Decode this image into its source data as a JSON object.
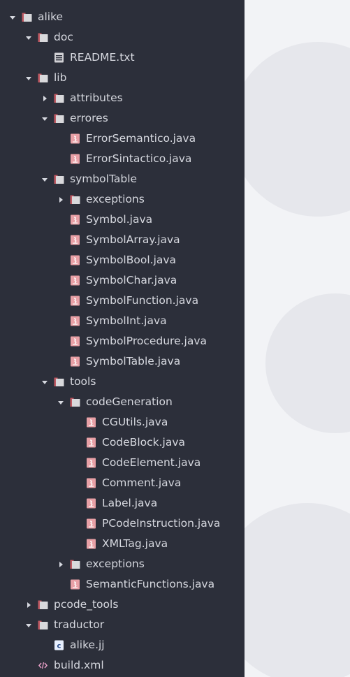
{
  "colors": {
    "panel_bg": "#2c2f3a",
    "text": "#d6d8df",
    "folder_body": "#d9d9dc",
    "folder_tab": "#c05a63",
    "java_icon": "#e8a0a6",
    "text_icon": "#d0d0d4",
    "jj_icon": "#e8f0ff",
    "xml_icon": "#e9a0c8"
  },
  "tree": [
    {
      "label": "alike",
      "type": "folder",
      "state": "open",
      "level": 0
    },
    {
      "label": "doc",
      "type": "folder",
      "state": "open",
      "level": 1
    },
    {
      "label": "README.txt",
      "type": "text-file",
      "level": 2
    },
    {
      "label": "lib",
      "type": "folder",
      "state": "open",
      "level": 1
    },
    {
      "label": "attributes",
      "type": "folder",
      "state": "closed",
      "level": 2
    },
    {
      "label": "errores",
      "type": "folder",
      "state": "open",
      "level": 2
    },
    {
      "label": "ErrorSemantico.java",
      "type": "java-file",
      "level": 3
    },
    {
      "label": "ErrorSintactico.java",
      "type": "java-file",
      "level": 3
    },
    {
      "label": "symbolTable",
      "type": "folder",
      "state": "open",
      "level": 2
    },
    {
      "label": "exceptions",
      "type": "folder",
      "state": "closed",
      "level": 3
    },
    {
      "label": "Symbol.java",
      "type": "java-file",
      "level": 3
    },
    {
      "label": "SymbolArray.java",
      "type": "java-file",
      "level": 3
    },
    {
      "label": "SymbolBool.java",
      "type": "java-file",
      "level": 3
    },
    {
      "label": "SymbolChar.java",
      "type": "java-file",
      "level": 3
    },
    {
      "label": "SymbolFunction.java",
      "type": "java-file",
      "level": 3
    },
    {
      "label": "SymbolInt.java",
      "type": "java-file",
      "level": 3
    },
    {
      "label": "SymbolProcedure.java",
      "type": "java-file",
      "level": 3
    },
    {
      "label": "SymbolTable.java",
      "type": "java-file",
      "level": 3
    },
    {
      "label": "tools",
      "type": "folder",
      "state": "open",
      "level": 2
    },
    {
      "label": "codeGeneration",
      "type": "folder",
      "state": "open",
      "level": 3
    },
    {
      "label": "CGUtils.java",
      "type": "java-file",
      "level": 4
    },
    {
      "label": "CodeBlock.java",
      "type": "java-file",
      "level": 4
    },
    {
      "label": "CodeElement.java",
      "type": "java-file",
      "level": 4
    },
    {
      "label": "Comment.java",
      "type": "java-file",
      "level": 4
    },
    {
      "label": "Label.java",
      "type": "java-file",
      "level": 4
    },
    {
      "label": "PCodeInstruction.java",
      "type": "java-file",
      "level": 4
    },
    {
      "label": "XMLTag.java",
      "type": "java-file",
      "level": 4
    },
    {
      "label": "exceptions",
      "type": "folder",
      "state": "closed",
      "level": 3
    },
    {
      "label": "SemanticFunctions.java",
      "type": "java-file",
      "level": 3
    },
    {
      "label": "pcode_tools",
      "type": "folder",
      "state": "closed",
      "level": 1
    },
    {
      "label": "traductor",
      "type": "folder",
      "state": "open",
      "level": 1
    },
    {
      "label": "alike.jj",
      "type": "jj-file",
      "level": 2
    },
    {
      "label": "build.xml",
      "type": "xml-file",
      "level": 1
    }
  ]
}
